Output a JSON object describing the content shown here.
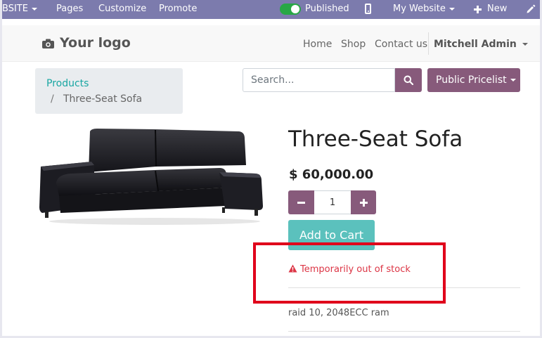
{
  "admin_bar": {
    "website_menu": "BSITE",
    "pages": "Pages",
    "customize": "Customize",
    "promote": "Promote",
    "published": "Published",
    "my_website": "My Website",
    "new": "New"
  },
  "header": {
    "logo": "Your logo",
    "nav": [
      "Home",
      "Shop",
      "Contact us"
    ],
    "user": "Mitchell Admin"
  },
  "breadcrumb": {
    "parent": "Products",
    "separator": "/",
    "current": "Three-Seat Sofa"
  },
  "search": {
    "placeholder": "Search..."
  },
  "pricelist": "Public Pricelist",
  "product": {
    "title": "Three-Seat Sofa",
    "price": "$ 60,000.00",
    "quantity": "1",
    "add_to_cart": "Add to Cart",
    "stock_warning": "Temporarily out of stock",
    "description": "raid 10, 2048ECC ram"
  },
  "colors": {
    "admin_bar": "#7c7bad",
    "primary": "#875a7b",
    "add_to_cart": "#5bc1bd",
    "link": "#18a6a2",
    "warning": "#dc3545",
    "highlight": "#e0001b"
  }
}
